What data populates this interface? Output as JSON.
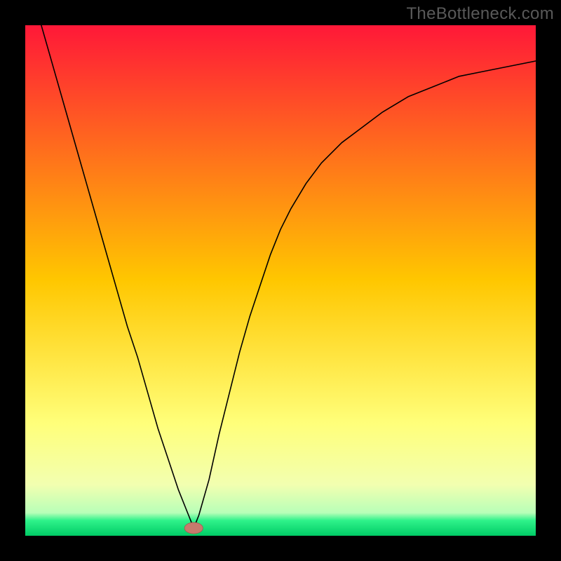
{
  "watermark": "TheBottleneck.com",
  "colors": {
    "top": "#ff1838",
    "mid": "#ffd500",
    "green": "#00e676",
    "curve": "#000000",
    "marker_fill": "#c77a6d",
    "marker_stroke": "#a05c50",
    "frame": "#000000"
  },
  "chart_data": {
    "type": "line",
    "title": "",
    "xlabel": "",
    "ylabel": "",
    "xlim": [
      0,
      100
    ],
    "ylim": [
      0,
      100
    ],
    "gradient_stops": [
      {
        "offset": 0.0,
        "color": "#ff1838"
      },
      {
        "offset": 0.5,
        "color": "#ffc700"
      },
      {
        "offset": 0.78,
        "color": "#ffff7a"
      },
      {
        "offset": 0.9,
        "color": "#f2ffb0"
      },
      {
        "offset": 0.955,
        "color": "#b8ffb8"
      },
      {
        "offset": 0.97,
        "color": "#2ff28a"
      },
      {
        "offset": 1.0,
        "color": "#00cc66"
      }
    ],
    "series": [
      {
        "name": "bottleneck-curve",
        "x": [
          0,
          2,
          4,
          6,
          8,
          10,
          12,
          14,
          16,
          18,
          20,
          22,
          24,
          26,
          28,
          30,
          32,
          33,
          34,
          36,
          38,
          40,
          42,
          44,
          46,
          48,
          50,
          52,
          55,
          58,
          62,
          66,
          70,
          75,
          80,
          85,
          90,
          95,
          100
        ],
        "y": [
          110,
          104,
          97,
          90,
          83,
          76,
          69,
          62,
          55,
          48,
          41,
          35,
          28,
          21,
          15,
          9,
          4,
          1.5,
          4,
          11,
          20,
          28,
          36,
          43,
          49,
          55,
          60,
          64,
          69,
          73,
          77,
          80,
          83,
          86,
          88,
          90,
          91,
          92,
          93
        ]
      }
    ],
    "marker": {
      "x": 33,
      "y": 1.5,
      "rx": 1.8,
      "ry": 1.1
    }
  }
}
